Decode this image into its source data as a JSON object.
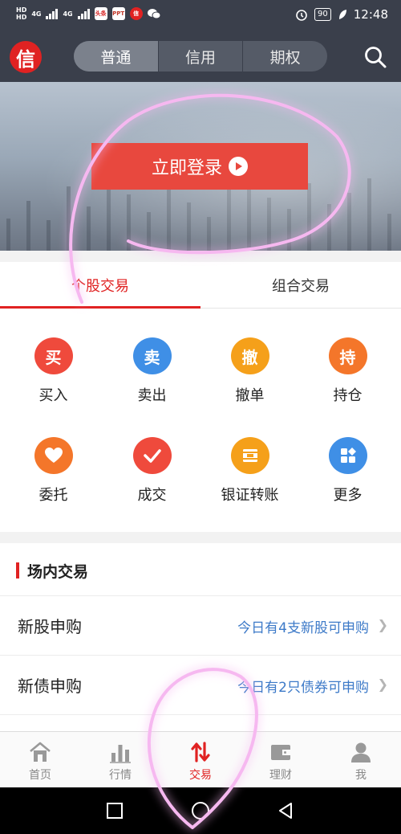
{
  "status_bar": {
    "hd_label": "HD",
    "net_label": "4G",
    "app_badges": [
      "头条",
      "PPT",
      "信"
    ],
    "battery": "90",
    "time": "12:48"
  },
  "header": {
    "logo": "信",
    "segments": [
      {
        "label": "普通",
        "active": true
      },
      {
        "label": "信用",
        "active": false
      },
      {
        "label": "期权",
        "active": false
      }
    ],
    "search_icon": "search-icon"
  },
  "banner": {
    "login_label": "立即登录",
    "button_color": "#e8483e"
  },
  "trade_tabs": [
    {
      "label": "个股交易",
      "active": true
    },
    {
      "label": "组合交易",
      "active": false
    }
  ],
  "actions": [
    {
      "glyph": "买",
      "label": "买入",
      "color": "#ef4a3c",
      "icon": "buy-icon"
    },
    {
      "glyph": "卖",
      "label": "卖出",
      "color": "#3f8fe6",
      "icon": "sell-icon"
    },
    {
      "glyph": "撤",
      "label": "撤单",
      "color": "#f5a01a",
      "icon": "cancel-order-icon"
    },
    {
      "glyph": "持",
      "label": "持仓",
      "color": "#f4762a",
      "icon": "holdings-icon"
    },
    {
      "glyph": "",
      "label": "委托",
      "color": "#f4762a",
      "icon": "heart-icon"
    },
    {
      "glyph": "",
      "label": "成交",
      "color": "#ef4a3c",
      "icon": "check-icon"
    },
    {
      "glyph": "",
      "label": "银证转账",
      "color": "#f5a01a",
      "icon": "transfer-icon"
    },
    {
      "glyph": "",
      "label": "更多",
      "color": "#3f8fe6",
      "icon": "grid-more-icon"
    }
  ],
  "market": {
    "title": "场内交易",
    "rows": [
      {
        "label": "新股申购",
        "info": "今日有4支新股可申购"
      },
      {
        "label": "新债申购",
        "info": "今日有2只债券可申购"
      }
    ]
  },
  "tabbar": [
    {
      "label": "首页",
      "icon": "home-icon",
      "active": false
    },
    {
      "label": "行情",
      "icon": "chart-icon",
      "active": false
    },
    {
      "label": "交易",
      "icon": "trade-icon",
      "active": true
    },
    {
      "label": "理财",
      "icon": "wallet-icon",
      "active": false
    },
    {
      "label": "我",
      "icon": "user-icon",
      "active": false
    }
  ],
  "colors": {
    "accent": "#e02222",
    "header_bg": "#3a3f4b",
    "link": "#3d7ac8",
    "annotation": "#e870e0"
  }
}
